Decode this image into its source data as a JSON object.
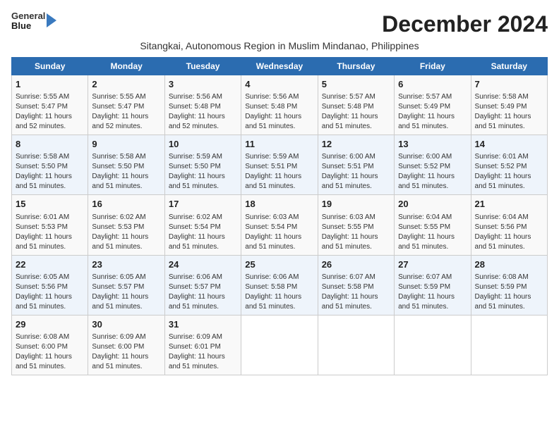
{
  "logo": {
    "line1": "General",
    "line2": "Blue"
  },
  "title": "December 2024",
  "subtitle": "Sitangkai, Autonomous Region in Muslim Mindanao, Philippines",
  "days_of_week": [
    "Sunday",
    "Monday",
    "Tuesday",
    "Wednesday",
    "Thursday",
    "Friday",
    "Saturday"
  ],
  "weeks": [
    [
      {
        "day": 1,
        "info": "Sunrise: 5:55 AM\nSunset: 5:47 PM\nDaylight: 11 hours\nand 52 minutes."
      },
      {
        "day": 2,
        "info": "Sunrise: 5:55 AM\nSunset: 5:47 PM\nDaylight: 11 hours\nand 52 minutes."
      },
      {
        "day": 3,
        "info": "Sunrise: 5:56 AM\nSunset: 5:48 PM\nDaylight: 11 hours\nand 52 minutes."
      },
      {
        "day": 4,
        "info": "Sunrise: 5:56 AM\nSunset: 5:48 PM\nDaylight: 11 hours\nand 51 minutes."
      },
      {
        "day": 5,
        "info": "Sunrise: 5:57 AM\nSunset: 5:48 PM\nDaylight: 11 hours\nand 51 minutes."
      },
      {
        "day": 6,
        "info": "Sunrise: 5:57 AM\nSunset: 5:49 PM\nDaylight: 11 hours\nand 51 minutes."
      },
      {
        "day": 7,
        "info": "Sunrise: 5:58 AM\nSunset: 5:49 PM\nDaylight: 11 hours\nand 51 minutes."
      }
    ],
    [
      {
        "day": 8,
        "info": "Sunrise: 5:58 AM\nSunset: 5:50 PM\nDaylight: 11 hours\nand 51 minutes."
      },
      {
        "day": 9,
        "info": "Sunrise: 5:58 AM\nSunset: 5:50 PM\nDaylight: 11 hours\nand 51 minutes."
      },
      {
        "day": 10,
        "info": "Sunrise: 5:59 AM\nSunset: 5:50 PM\nDaylight: 11 hours\nand 51 minutes."
      },
      {
        "day": 11,
        "info": "Sunrise: 5:59 AM\nSunset: 5:51 PM\nDaylight: 11 hours\nand 51 minutes."
      },
      {
        "day": 12,
        "info": "Sunrise: 6:00 AM\nSunset: 5:51 PM\nDaylight: 11 hours\nand 51 minutes."
      },
      {
        "day": 13,
        "info": "Sunrise: 6:00 AM\nSunset: 5:52 PM\nDaylight: 11 hours\nand 51 minutes."
      },
      {
        "day": 14,
        "info": "Sunrise: 6:01 AM\nSunset: 5:52 PM\nDaylight: 11 hours\nand 51 minutes."
      }
    ],
    [
      {
        "day": 15,
        "info": "Sunrise: 6:01 AM\nSunset: 5:53 PM\nDaylight: 11 hours\nand 51 minutes."
      },
      {
        "day": 16,
        "info": "Sunrise: 6:02 AM\nSunset: 5:53 PM\nDaylight: 11 hours\nand 51 minutes."
      },
      {
        "day": 17,
        "info": "Sunrise: 6:02 AM\nSunset: 5:54 PM\nDaylight: 11 hours\nand 51 minutes."
      },
      {
        "day": 18,
        "info": "Sunrise: 6:03 AM\nSunset: 5:54 PM\nDaylight: 11 hours\nand 51 minutes."
      },
      {
        "day": 19,
        "info": "Sunrise: 6:03 AM\nSunset: 5:55 PM\nDaylight: 11 hours\nand 51 minutes."
      },
      {
        "day": 20,
        "info": "Sunrise: 6:04 AM\nSunset: 5:55 PM\nDaylight: 11 hours\nand 51 minutes."
      },
      {
        "day": 21,
        "info": "Sunrise: 6:04 AM\nSunset: 5:56 PM\nDaylight: 11 hours\nand 51 minutes."
      }
    ],
    [
      {
        "day": 22,
        "info": "Sunrise: 6:05 AM\nSunset: 5:56 PM\nDaylight: 11 hours\nand 51 minutes."
      },
      {
        "day": 23,
        "info": "Sunrise: 6:05 AM\nSunset: 5:57 PM\nDaylight: 11 hours\nand 51 minutes."
      },
      {
        "day": 24,
        "info": "Sunrise: 6:06 AM\nSunset: 5:57 PM\nDaylight: 11 hours\nand 51 minutes."
      },
      {
        "day": 25,
        "info": "Sunrise: 6:06 AM\nSunset: 5:58 PM\nDaylight: 11 hours\nand 51 minutes."
      },
      {
        "day": 26,
        "info": "Sunrise: 6:07 AM\nSunset: 5:58 PM\nDaylight: 11 hours\nand 51 minutes."
      },
      {
        "day": 27,
        "info": "Sunrise: 6:07 AM\nSunset: 5:59 PM\nDaylight: 11 hours\nand 51 minutes."
      },
      {
        "day": 28,
        "info": "Sunrise: 6:08 AM\nSunset: 5:59 PM\nDaylight: 11 hours\nand 51 minutes."
      }
    ],
    [
      {
        "day": 29,
        "info": "Sunrise: 6:08 AM\nSunset: 6:00 PM\nDaylight: 11 hours\nand 51 minutes."
      },
      {
        "day": 30,
        "info": "Sunrise: 6:09 AM\nSunset: 6:00 PM\nDaylight: 11 hours\nand 51 minutes."
      },
      {
        "day": 31,
        "info": "Sunrise: 6:09 AM\nSunset: 6:01 PM\nDaylight: 11 hours\nand 51 minutes."
      },
      null,
      null,
      null,
      null
    ]
  ]
}
